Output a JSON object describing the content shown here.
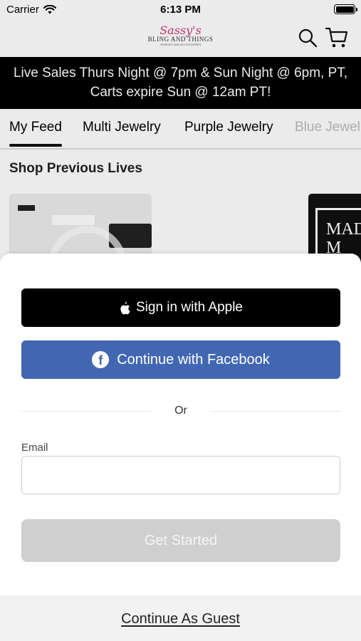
{
  "status_bar": {
    "carrier": "Carrier",
    "time": "6:13 PM"
  },
  "header": {
    "logo_script": "Sassy's",
    "logo_name": "BLING AND THINGS",
    "logo_tagline": "JEWELRY AND ACCESSORIES"
  },
  "banner": {
    "line1": "Live Sales Thurs Night @ 7pm & Sun Night @ 6pm, PT,",
    "line2": "Carts expire Sun @ 12am PT!"
  },
  "tabs": [
    {
      "label": "My Feed",
      "active": true
    },
    {
      "label": "Multi Jewelry",
      "active": false
    },
    {
      "label": "Purple Jewelry",
      "active": false
    },
    {
      "label": "Blue Jewelry",
      "active": false
    }
  ],
  "feed": {
    "section_title": "Shop Previous Lives",
    "card2_text": "MAD M"
  },
  "sheet": {
    "apple_label": "Sign in with Apple",
    "facebook_label": "Continue with Facebook",
    "or_label": "Or",
    "email_label": "Email",
    "email_value": "",
    "email_placeholder": "",
    "start_label": "Get Started",
    "guest_label": "Continue As Guest"
  },
  "colors": {
    "facebook": "#4267b2",
    "banner_bg": "#000000",
    "disabled_button": "#cfcfcf",
    "logo_pink": "#d3397a"
  },
  "icons": [
    "wifi-icon",
    "battery-icon",
    "search-icon",
    "cart-icon",
    "apple-icon",
    "facebook-icon",
    "play-icon"
  ]
}
